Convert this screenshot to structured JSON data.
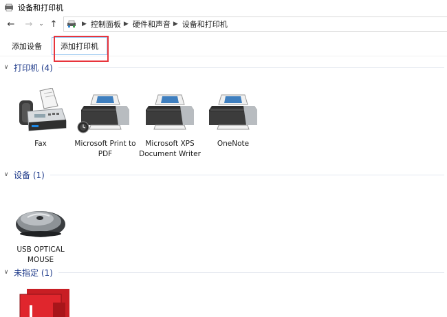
{
  "window": {
    "title": "设备和打印机"
  },
  "nav": {
    "back": "←",
    "forward": "→",
    "up": "↑",
    "recent": "⌄"
  },
  "breadcrumb": {
    "items": [
      "控制面板",
      "硬件和声音",
      "设备和打印机"
    ]
  },
  "toolbar": {
    "add_device": "添加设备",
    "add_printer": "添加打印机"
  },
  "groups": {
    "printers": {
      "label": "打印机 (4)"
    },
    "devices": {
      "label": "设备 (1)"
    },
    "unspecified": {
      "label": "未指定 (1)"
    }
  },
  "printers": [
    {
      "name": "Fax",
      "icon": "fax-icon"
    },
    {
      "name": "Microsoft Print to PDF",
      "icon": "printer-icon",
      "default": true
    },
    {
      "name": "Microsoft XPS Document Writer",
      "icon": "printer-icon"
    },
    {
      "name": "OneNote",
      "icon": "printer-icon"
    }
  ],
  "devices": [
    {
      "name": "USB OPTICAL MOUSE",
      "icon": "mouse-icon"
    }
  ],
  "unspecified": [
    {
      "name": "",
      "icon": "unspecified-device-icon"
    }
  ],
  "colors": {
    "group_label": "#1e3a8a",
    "highlight": "#e8343c",
    "hover_border": "#9fcaf0"
  }
}
